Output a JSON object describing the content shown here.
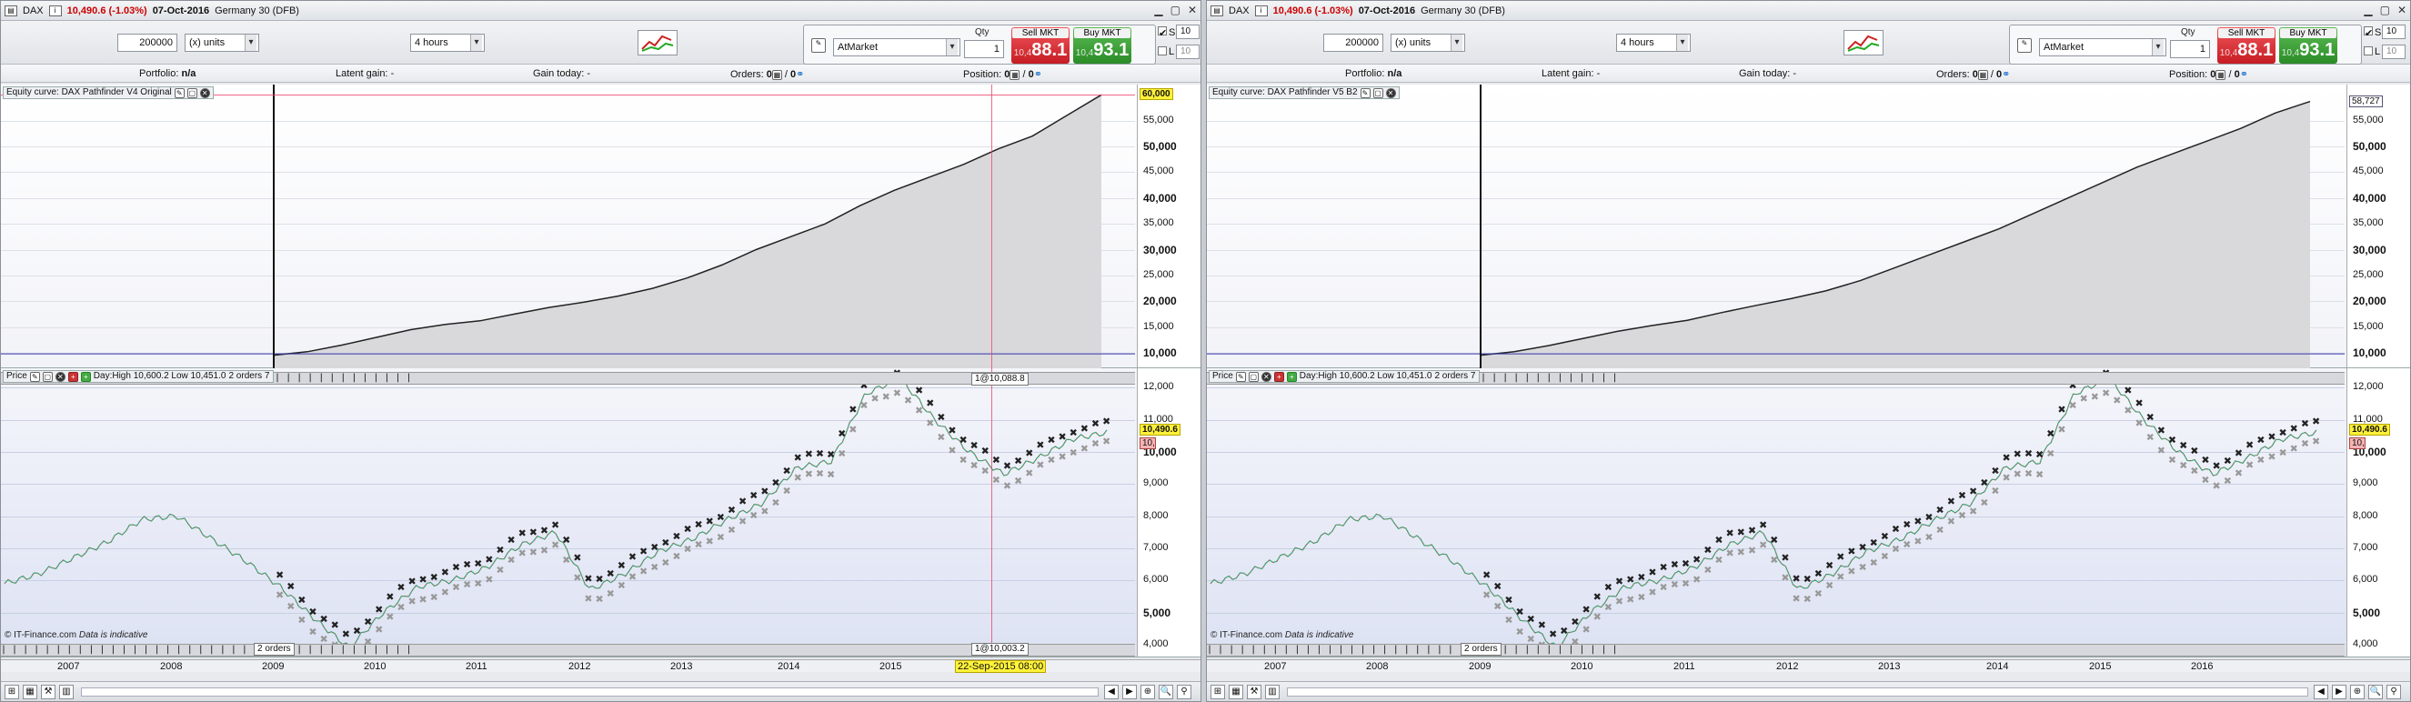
{
  "windows": [
    {
      "id": "w1",
      "title": {
        "instrument": "DAX",
        "quote": "10,490.6 (-1.03%)",
        "date": "07-Oct-2016",
        "market": "Germany 30 (DFB)"
      },
      "toolbar": {
        "amount": "200000",
        "unit_select": "(x) units",
        "timeframe": "4 hours",
        "order_type": "AtMarket",
        "qty_label": "Qty",
        "qty_value": "1",
        "sell_label": "Sell MKT",
        "sell_prefix": "10,4",
        "sell_price": "88.1",
        "buy_label": "Buy MKT",
        "buy_prefix": "10,4",
        "buy_price": "93.1",
        "s_label": "S",
        "s_value": "10",
        "l_label": "L",
        "l_value": "10"
      },
      "info": {
        "portfolio_label": "Portfolio:",
        "portfolio_value": "n/a",
        "latent_label": "Latent gain:",
        "latent_value": "-",
        "gain_label": "Gain today:",
        "gain_value": "-",
        "orders_label": "Orders:",
        "orders_a": "0",
        "orders_b": "0",
        "position_label": "Position:",
        "position_a": "0",
        "position_b": "0"
      },
      "equity": {
        "label": "Equity curve: DAX Pathfinder V4 Original",
        "ticks": [
          "55,000",
          "50,000",
          "45,000",
          "40,000",
          "35,000",
          "30,000",
          "25,000",
          "20,000",
          "15,000",
          "10,000"
        ],
        "highlight": "60,000"
      },
      "price": {
        "label": "Price",
        "daytext": "Day:High 10,600.2 Low 10,451.0",
        "ticks": [
          "12,000",
          "11,000",
          "10,000",
          "9,000",
          "8,000",
          "7,000",
          "6,000",
          "5,000",
          "4,000"
        ],
        "current": "10,490.6",
        "current_red": "10,488.1",
        "orders_top": "2 orders 7",
        "orders_bottom": "2 orders",
        "cursor_top": "1@10,088.8",
        "cursor_bottom": "1@10,003.2"
      },
      "watermark": "© IT-Finance.com",
      "watermark_note": "Data is indicative",
      "xaxis": {
        "years": [
          "2007",
          "2008",
          "2009",
          "2010",
          "2011",
          "2012",
          "2013",
          "2014",
          "2015"
        ],
        "cursor_date": "22-Sep-2015 08:00"
      }
    },
    {
      "id": "w2",
      "title": {
        "instrument": "DAX",
        "quote": "10,490.6 (-1.03%)",
        "date": "07-Oct-2016",
        "market": "Germany 30 (DFB)"
      },
      "toolbar": {
        "amount": "200000",
        "unit_select": "(x) units",
        "timeframe": "4 hours",
        "order_type": "AtMarket",
        "qty_label": "Qty",
        "qty_value": "1",
        "sell_label": "Sell MKT",
        "sell_prefix": "10,4",
        "sell_price": "88.1",
        "buy_label": "Buy MKT",
        "buy_prefix": "10,4",
        "buy_price": "93.1",
        "s_label": "S",
        "s_value": "10",
        "l_label": "L",
        "l_value": "10"
      },
      "info": {
        "portfolio_label": "Portfolio:",
        "portfolio_value": "n/a",
        "latent_label": "Latent gain:",
        "latent_value": "-",
        "gain_label": "Gain today:",
        "gain_value": "-",
        "orders_label": "Orders:",
        "orders_a": "0",
        "orders_b": "0",
        "position_label": "Position:",
        "position_a": "0",
        "position_b": "0"
      },
      "equity": {
        "label": "Equity curve: DAX Pathfinder V5 B2",
        "ticks": [
          "55,000",
          "50,000",
          "45,000",
          "40,000",
          "35,000",
          "30,000",
          "25,000",
          "20,000",
          "15,000",
          "10,000"
        ],
        "highlight": "58,727"
      },
      "price": {
        "label": "Price",
        "daytext": "Day:High 10,600.2 Low 10,451.0",
        "ticks": [
          "12,000",
          "11,000",
          "10,000",
          "9,000",
          "8,000",
          "7,000",
          "6,000",
          "5,000",
          "4,000"
        ],
        "current": "10,490.6",
        "current_red": "10,488.1",
        "orders_top": "2 orders 7",
        "orders_bottom": "2 orders",
        "cursor_top": "",
        "cursor_bottom": ""
      },
      "watermark": "© IT-Finance.com",
      "watermark_note": "Data is indicative",
      "xaxis": {
        "years": [
          "2007",
          "2008",
          "2009",
          "2010",
          "2011",
          "2012",
          "2013",
          "2014",
          "2015",
          "2016"
        ],
        "cursor_date": ""
      }
    }
  ],
  "chart_data": [
    {
      "type": "area",
      "title": "Equity curve: DAX Pathfinder V4 Original",
      "x_start": "2009",
      "x_end": "2016-10",
      "ylim": [
        7000,
        62000
      ],
      "y": [
        9500,
        10200,
        11500,
        13000,
        14500,
        15500,
        16200,
        17500,
        18800,
        19800,
        21000,
        22500,
        24500,
        27000,
        30000,
        32500,
        35000,
        38500,
        41500,
        44000,
        46500,
        49500,
        52000,
        56000,
        60000
      ]
    },
    {
      "type": "area",
      "title": "Equity curve: DAX Pathfinder V5 B2",
      "x_start": "2009",
      "x_end": "2016-10",
      "ylim": [
        7000,
        62000
      ],
      "y": [
        9500,
        10200,
        11400,
        12800,
        14200,
        15300,
        16300,
        17800,
        19200,
        20500,
        22000,
        24000,
        26500,
        29000,
        31500,
        34000,
        37000,
        40000,
        43000,
        46000,
        48500,
        51000,
        53500,
        56500,
        58727
      ]
    },
    {
      "type": "line",
      "title": "DAX Price",
      "x_start": "2006-10",
      "x_end": "2016-10",
      "ylim": [
        3600,
        12600
      ],
      "y": [
        5900,
        6200,
        6700,
        7200,
        7900,
        8000,
        7300,
        6600,
        5800,
        4800,
        3900,
        5000,
        5800,
        6000,
        6400,
        7100,
        7500,
        5700,
        6200,
        6900,
        7300,
        7900,
        8400,
        9500,
        9700,
        11800,
        12300,
        11000,
        10000,
        9300,
        9800,
        10400,
        10600
      ]
    }
  ]
}
